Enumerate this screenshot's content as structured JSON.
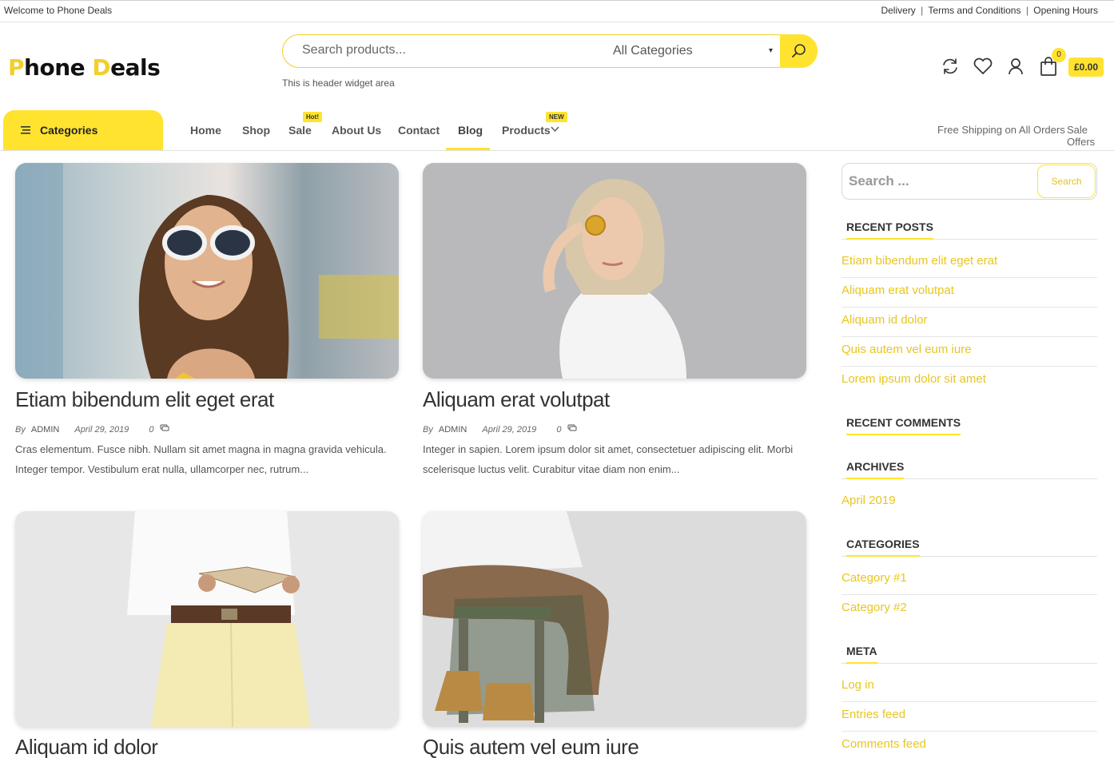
{
  "topbar": {
    "welcome": "Welcome to Phone Deals",
    "links": [
      "Delivery",
      "Terms and Conditions",
      "Opening Hours"
    ],
    "separator": "|"
  },
  "logo": {
    "first_letter": "P",
    "part1": "hone ",
    "second_letter": "D",
    "part2": "eals"
  },
  "search": {
    "placeholder": "Search products...",
    "category": "All Categories",
    "category_caret": "▾",
    "note": "This is header widget area"
  },
  "header_icons": {
    "names": [
      "refresh-icon",
      "heart-icon",
      "user-icon",
      "bag-icon"
    ],
    "cart_count": "0",
    "cart_total": "£0.00"
  },
  "nav": {
    "categories_label": "Categories",
    "items": [
      {
        "label": "Home"
      },
      {
        "label": "Shop"
      },
      {
        "label": "Sale",
        "tag": "Hot!"
      },
      {
        "label": "About Us"
      },
      {
        "label": "Contact"
      },
      {
        "label": "Blog",
        "active": true
      },
      {
        "label": "Products",
        "tag": "NEW",
        "has_dropdown": true
      }
    ],
    "right_links": [
      "Free Shipping on All Orders",
      "Sale Offers"
    ]
  },
  "posts": [
    {
      "title": "Etiam bibendum elit eget erat",
      "by": "By",
      "author": "ADMIN",
      "date": "April 29, 2019",
      "comments": "0",
      "excerpt": "Cras elementum. Fusce nibh. Nullam sit amet magna in magna gravida vehicula. Integer tempor. Vestibulum erat nulla, ullamcorper nec, rutrum..."
    },
    {
      "title": "Aliquam erat volutpat",
      "by": "By",
      "author": "ADMIN",
      "date": "April 29, 2019",
      "comments": "0",
      "excerpt": "Integer in sapien. Lorem ipsum dolor sit amet, consectetuer adipiscing elit. Morbi scelerisque luctus velit. Curabitur vitae diam non enim..."
    },
    {
      "title": "Aliquam id dolor"
    },
    {
      "title": "Quis autem vel eum iure"
    }
  ],
  "sidebar": {
    "search_placeholder": "Search ...",
    "search_button": "Search",
    "recent_posts_title": "RECENT POSTS",
    "recent_posts": [
      "Etiam bibendum elit eget erat",
      "Aliquam erat volutpat",
      "Aliquam id dolor",
      "Quis autem vel eum iure",
      "Lorem ipsum dolor sit amet"
    ],
    "recent_comments_title": "RECENT COMMENTS",
    "archives_title": "ARCHIVES",
    "archives": [
      "April 2019"
    ],
    "categories_title": "CATEGORIES",
    "categories": [
      "Category #1",
      "Category #2"
    ],
    "meta_title": "META",
    "meta": [
      "Log in",
      "Entries feed",
      "Comments feed"
    ]
  },
  "colors": {
    "accent": "#ffe32f",
    "link": "#e8c620"
  }
}
